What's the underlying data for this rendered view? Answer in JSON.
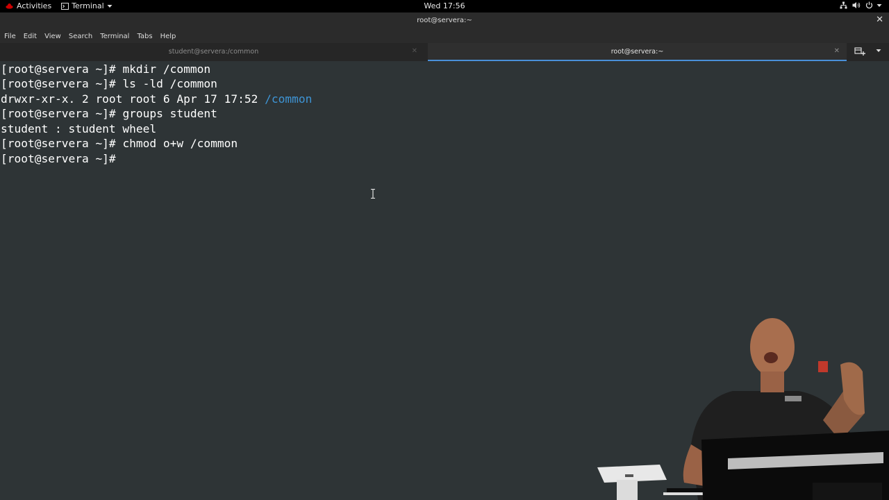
{
  "topbar": {
    "activities": "Activities",
    "app_name": "Terminal",
    "clock": "Wed 17:56"
  },
  "window": {
    "title": "root@servera:~"
  },
  "menu": [
    "File",
    "Edit",
    "View",
    "Search",
    "Terminal",
    "Tabs",
    "Help"
  ],
  "tabs": [
    {
      "label": "student@servera:/common",
      "active": false
    },
    {
      "label": "root@servera:~",
      "active": true
    }
  ],
  "terminal": {
    "prompt": "[root@servera ~]# ",
    "lines": [
      {
        "cmd": "mkdir /common"
      },
      {
        "cmd": "ls -ld /common"
      },
      {
        "text": "drwxr-xr-x. 2 root root 6 Apr 17 17:52 ",
        "dir": "/common"
      },
      {
        "cmd": "groups student"
      },
      {
        "text": "student : student wheel"
      },
      {
        "cmd": "chmod o+w /common"
      },
      {
        "cmd": ""
      }
    ]
  },
  "colors": {
    "terminal_bg": "#2e3436",
    "terminal_fg": "#ffffff",
    "directory": "#3e95d6",
    "tab_accent": "#4a90d9",
    "topbar_bg": "#000000"
  }
}
